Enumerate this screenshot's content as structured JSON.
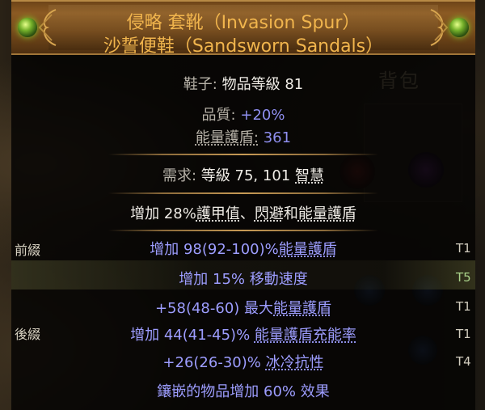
{
  "inventory": {
    "label": "背包"
  },
  "item": {
    "name": "侵略 套靴（Invasion Spur）",
    "base": "沙誓便鞋（Sandsworn Sandals）",
    "type_label": "鞋子:",
    "item_level_label": "物品等級",
    "item_level": "81",
    "quality_label": "品質:",
    "quality": "+20%",
    "es_label": "能量護盾:",
    "es": "361",
    "req_label": "需求:",
    "req_level_label": "等級",
    "req_level": "75,",
    "req_int_value": "101",
    "req_int_label": "智慧",
    "implicit_prefix": "增加 28%",
    "implicit_armour": "護甲值",
    "implicit_sep1": "、",
    "implicit_evasion": "閃避",
    "implicit_and": "和",
    "implicit_es": "能量護盾",
    "mods": [
      {
        "pre": "增加 98(92-100)%",
        "kw": "能量護盾",
        "post": "",
        "tier": "T1"
      },
      {
        "pre": "增加 15% 移動速度",
        "kw": "",
        "post": "",
        "tier": "T5"
      },
      {
        "pre": "+58(48-60) 最大",
        "kw": "能量護盾",
        "post": "",
        "tier": "T1"
      },
      {
        "pre": "增加 44(41-45)% ",
        "kw": "能量護盾充能率",
        "post": "",
        "tier": "T1"
      },
      {
        "pre": "+26(26-30)% ",
        "kw": "冰冷抗性",
        "post": "",
        "tier": "T4"
      }
    ],
    "prefix_label": "前綴",
    "suffix_label": "後綴",
    "enchant": "鑲嵌的物品增加 60% 效果"
  },
  "colors": {
    "title": "#f1b54d",
    "magic": "#9d9dff",
    "grey": "#b7b2a8"
  },
  "icons": [
    "gem-icon",
    "ornament-icon"
  ]
}
